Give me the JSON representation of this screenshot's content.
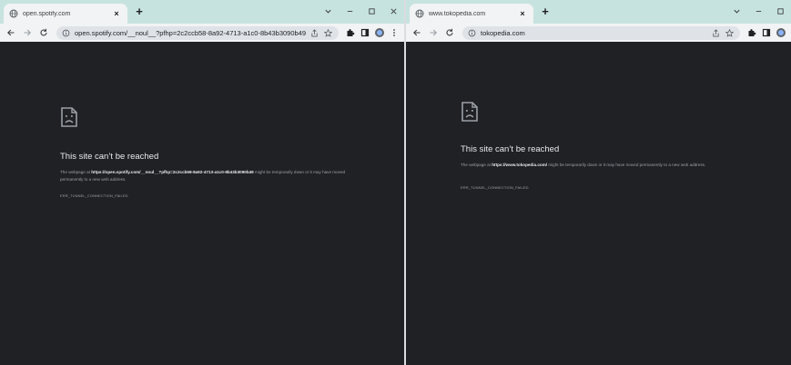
{
  "left_window": {
    "tab_title": "open.spotify.com",
    "tab_close": "×",
    "new_tab": "+",
    "url": "open.spotify.com/__noul__?pfhp=2c2ccb58-8a92-4713-a1c0-8b43b3090b49",
    "error": {
      "title": "This site can’t be reached",
      "msg_prefix": "The webpage at ",
      "msg_url": "https://open.spotify.com/__noul__?pfhp=2c2ccb58-8a92-4713-a1c0-8b43b3090b49",
      "msg_suffix": " might be temporarily down or it may have moved permanently to a new web address.",
      "code": "ERR_TUNNEL_CONNECTION_FAILED"
    }
  },
  "right_window": {
    "tab_title": "www.tokopedia.com",
    "tab_close": "×",
    "new_tab": "+",
    "url": "tokopedia.com",
    "error": {
      "title": "This site can’t be reached",
      "msg_prefix": "The webpage at ",
      "msg_url": "https://www.tokopedia.com/",
      "msg_suffix": " might be temporarily down or it may have moved permanently to a new web address.",
      "code": "ERR_TUNNEL_CONNECTION_FAILED"
    }
  },
  "colors": {
    "page_background": "#202124",
    "tab_strip": "#c7e3df",
    "toolbar": "#f1f3f4"
  }
}
